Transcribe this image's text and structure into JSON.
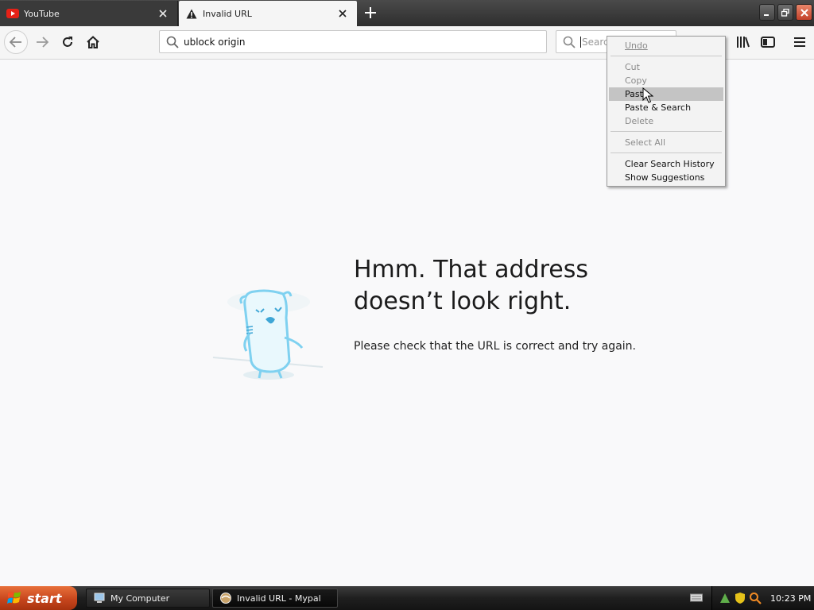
{
  "tabs": [
    {
      "title": "YouTube",
      "icon": "youtube-icon",
      "active": false
    },
    {
      "title": "Invalid URL",
      "icon": "warning-icon",
      "active": true
    }
  ],
  "navbar": {
    "url_value": "ublock origin",
    "search_placeholder": "Search"
  },
  "error_page": {
    "title_line1": "Hmm. That address",
    "title_line2": "doesn’t look right.",
    "description": "Please check that the URL is correct and try again."
  },
  "context_menu": {
    "items": [
      {
        "label": "Undo",
        "disabled": true
      },
      {
        "label": "Cut",
        "disabled": true
      },
      {
        "label": "Copy",
        "disabled": true
      },
      {
        "label": "Paste",
        "disabled": false,
        "highlighted": true
      },
      {
        "label": "Paste & Search",
        "disabled": false
      },
      {
        "label": "Delete",
        "disabled": true
      },
      {
        "label": "Select All",
        "disabled": true
      },
      {
        "label": "Clear Search History",
        "disabled": false
      },
      {
        "label": "Show Suggestions",
        "disabled": false
      }
    ]
  },
  "taskbar": {
    "start_label": "start",
    "tasks": [
      {
        "label": "My Computer",
        "active": false
      },
      {
        "label": "Invalid URL - Mypal",
        "active": true
      }
    ],
    "clock": "10:23 PM"
  },
  "colors": {
    "page_bg": "#f9f9fa",
    "mascot_blue": "#7fd1f0",
    "start_orange": "#d4552a",
    "youtube_red": "#e62117",
    "menu_highlight": "#c4c4c4"
  }
}
